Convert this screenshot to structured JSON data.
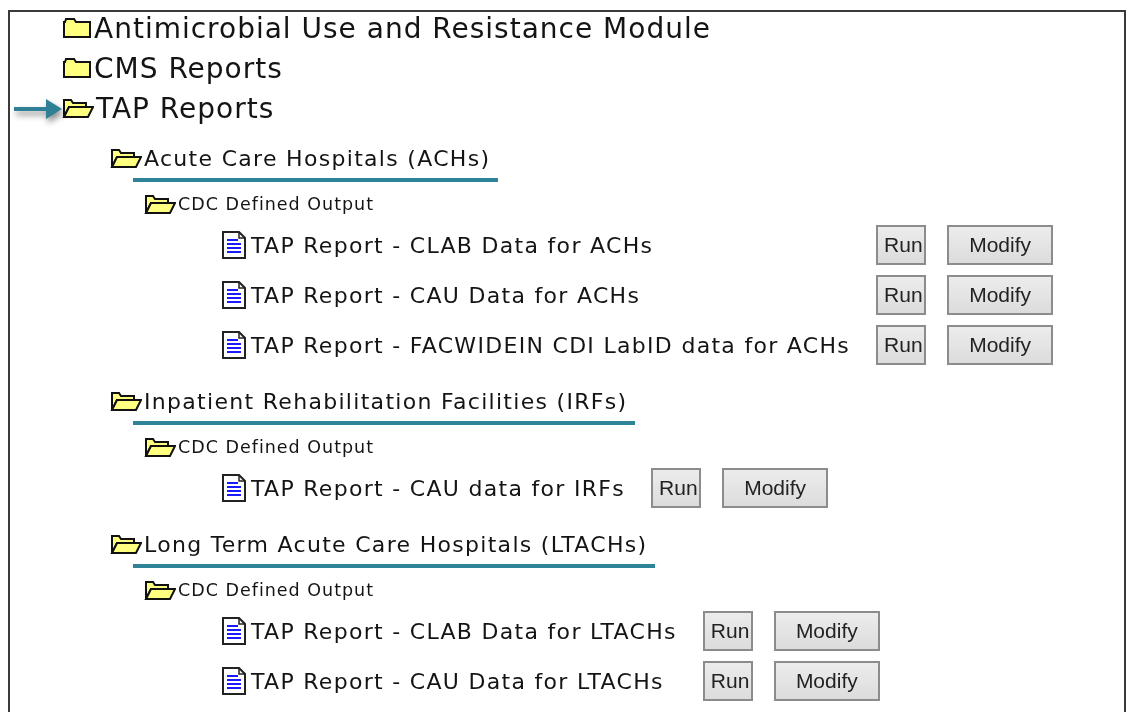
{
  "tree": [
    {
      "kind": "folder",
      "label": "Antimicrobial Use and Resistance Module",
      "expanded": false,
      "pointed": false
    },
    {
      "kind": "folder",
      "label": "CMS Reports",
      "expanded": false,
      "pointed": false
    },
    {
      "kind": "folder",
      "label": "TAP Reports",
      "expanded": true,
      "pointed": true,
      "children": [
        {
          "kind": "folder",
          "label": "Acute Care Hospitals (ACHs)",
          "expanded": true,
          "underlined": true,
          "children": [
            {
              "kind": "folder",
              "label": "CDC Defined Output",
              "expanded": true,
              "children": [
                {
                  "kind": "report",
                  "label": "TAP Report - CLAB Data for ACHs",
                  "buttons": [
                    {
                      "kind": "run",
                      "label": "Run"
                    },
                    {
                      "kind": "modify",
                      "label": "Modify"
                    }
                  ]
                },
                {
                  "kind": "report",
                  "label": "TAP Report - CAU Data for ACHs",
                  "buttons": [
                    {
                      "kind": "run",
                      "label": "Run"
                    },
                    {
                      "kind": "modify",
                      "label": "Modify"
                    }
                  ]
                },
                {
                  "kind": "report",
                  "label": "TAP Report - FACWIDEIN CDI LabID data for ACHs",
                  "buttons": [
                    {
                      "kind": "run",
                      "label": "Run"
                    },
                    {
                      "kind": "modify",
                      "label": "Modify"
                    }
                  ]
                }
              ]
            }
          ]
        },
        {
          "kind": "folder",
          "label": "Inpatient Rehabilitation Facilities (IRFs)",
          "expanded": true,
          "underlined": true,
          "children": [
            {
              "kind": "folder",
              "label": "CDC Defined Output",
              "expanded": true,
              "children": [
                {
                  "kind": "report",
                  "label": "TAP Report - CAU data for IRFs",
                  "buttons": [
                    {
                      "kind": "run",
                      "label": "Run"
                    },
                    {
                      "kind": "modify",
                      "label": "Modify"
                    }
                  ]
                }
              ]
            }
          ]
        },
        {
          "kind": "folder",
          "label": "Long Term Acute Care Hospitals (LTACHs)",
          "expanded": true,
          "underlined": true,
          "children": [
            {
              "kind": "folder",
              "label": "CDC Defined Output",
              "expanded": true,
              "children": [
                {
                  "kind": "report",
                  "label": "TAP Report - CLAB Data for LTACHs",
                  "buttons": [
                    {
                      "kind": "run",
                      "label": "Run"
                    },
                    {
                      "kind": "modify",
                      "label": "Modify"
                    }
                  ]
                },
                {
                  "kind": "report",
                  "label": "TAP Report - CAU Data for LTACHs",
                  "buttons": [
                    {
                      "kind": "run",
                      "label": "Run"
                    },
                    {
                      "kind": "modify",
                      "label": "Modify"
                    }
                  ]
                }
              ]
            }
          ]
        }
      ]
    }
  ]
}
